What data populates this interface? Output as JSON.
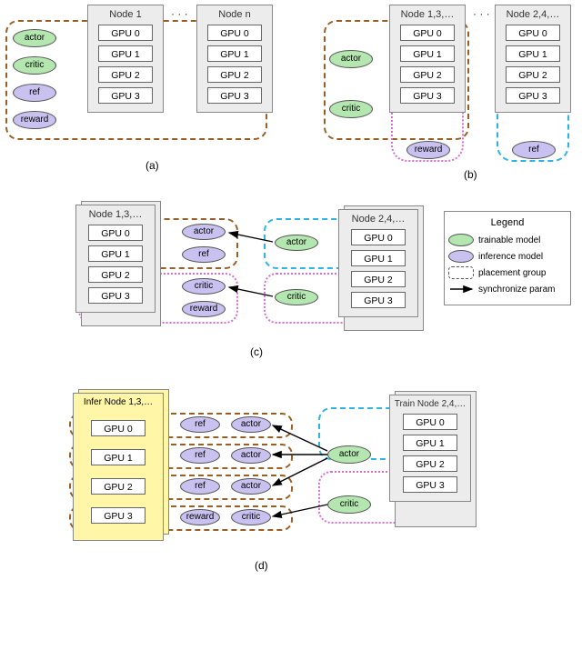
{
  "labels": {
    "ellipsisDots": "· · ·",
    "gpu0": "GPU 0",
    "gpu1": "GPU 1",
    "gpu2": "GPU 2",
    "gpu3": "GPU 3",
    "actor": "actor",
    "critic": "critic",
    "ref": "ref",
    "reward": "reward"
  },
  "panelA": {
    "node1Title": "Node 1",
    "nodeNTitle": "Node n",
    "caption": "(a)"
  },
  "panelB": {
    "node1Title": "Node 1,3,…",
    "node2Title": "Node 2,4,…",
    "caption": "(b)"
  },
  "panelC": {
    "node1Title": "Node 1,3,…",
    "node2Title": "Node 2,4,…",
    "caption": "(c)"
  },
  "panelD": {
    "inferTitle": "Infer Node 1,3,…",
    "trainTitle": "Train Node 2,4,…",
    "caption": "(d)"
  },
  "legend": {
    "title": "Legend",
    "trainable": "trainable model",
    "inference": "inference model",
    "placement": "placement group",
    "sync": "synchronize param"
  }
}
